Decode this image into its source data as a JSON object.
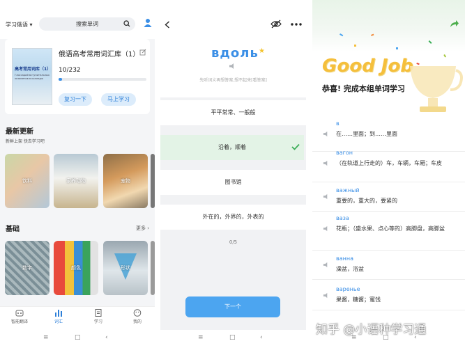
{
  "vocab": {
    "lang": "学习俄语",
    "search_placeholder": "搜索单词",
    "book_title": "俄语高考常用词汇库（1）",
    "progress_text": "10/232",
    "progress_fraction": 0.043,
    "cover_title": "高考常用词库（1）",
    "cover_sub": "Глоссарий вступительных экзаменов в колледж",
    "review_btn": "复习一下",
    "learn_btn": "马上学习",
    "latest_title": "最新更新",
    "latest_sub": "新鲜上架 快去学习吧",
    "basic_title": "基础",
    "more": "更多 ›",
    "latest_tiles": [
      "饮料",
      "家养动物",
      "宠物"
    ],
    "basic_tiles": [
      "数字",
      "颜色",
      "形状"
    ],
    "tabs": [
      "智能翻译",
      "词汇",
      "学习",
      "我的"
    ]
  },
  "quiz": {
    "word": "вдоль",
    "hint": "先听词义再想答案,想不起来[看答案]",
    "options": [
      "平平常常、一般般",
      "沿着，顺着",
      "图书馆",
      "外在的，外界的，外表的"
    ],
    "correct_index": 1,
    "count": "0/5",
    "next_btn": "下一个"
  },
  "result": {
    "banner": "Good Job",
    "congrats": "恭喜! 完成本组单词学习",
    "entries": [
      {
        "ru": "в",
        "zh": "在……里面；到……里面"
      },
      {
        "ru": "вагон",
        "zh": "（在轨道上行走的）车，车辆，车厢；车皮"
      },
      {
        "ru": "важный",
        "zh": "重要的，重大的，要紧的"
      },
      {
        "ru": "ваза",
        "zh": "花瓶；（盛水果、点心等的）高脚盘，高脚盆"
      },
      {
        "ru": "ванна",
        "zh": "澡盆，浴盆"
      },
      {
        "ru": "варенье",
        "zh": "果酱，糖酱；蜜饯"
      }
    ]
  },
  "watermark": "知乎 @小语种学习通",
  "colors": {
    "accent": "#3b8fe6",
    "correct_bg": "#e3f3e6",
    "gold": "#f5bf3c"
  }
}
